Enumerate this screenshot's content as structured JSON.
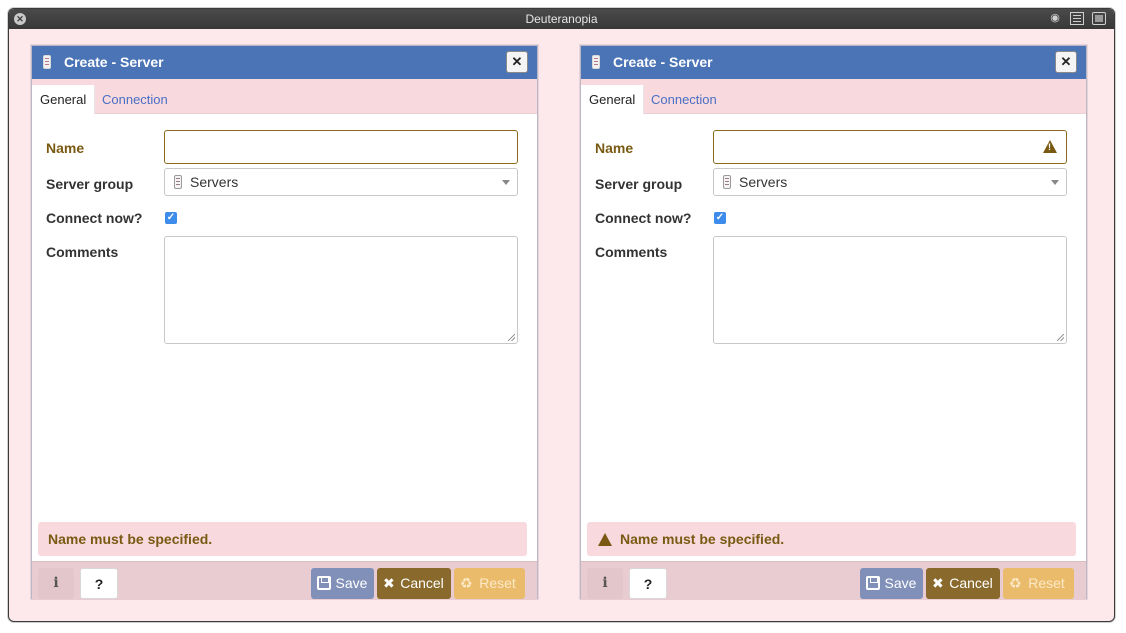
{
  "window": {
    "title": "Deuteranopia"
  },
  "dialogs": [
    {
      "title": "Create - Server",
      "tabs": [
        "General",
        "Connection"
      ],
      "fields": {
        "name_label": "Name",
        "name_value": "",
        "server_group_label": "Server group",
        "server_group_value": "Servers",
        "connect_now_label": "Connect now?",
        "connect_now_checked": true,
        "comments_label": "Comments",
        "comments_value": ""
      },
      "alert": "Name must be specified.",
      "buttons": {
        "info": "i",
        "help": "?",
        "save": "Save",
        "cancel": "Cancel",
        "reset": "Reset"
      }
    },
    {
      "title": "Create - Server",
      "tabs": [
        "General",
        "Connection"
      ],
      "fields": {
        "name_label": "Name",
        "name_value": "",
        "server_group_label": "Server group",
        "server_group_value": "Servers",
        "connect_now_label": "Connect now?",
        "connect_now_checked": true,
        "comments_label": "Comments",
        "comments_value": ""
      },
      "alert": "Name must be specified.",
      "buttons": {
        "info": "i",
        "help": "?",
        "save": "Save",
        "cancel": "Cancel",
        "reset": "Reset"
      }
    }
  ],
  "colors": {
    "header": "#4b74b6",
    "warning_text": "#7a5a12",
    "alert_bg": "#f7d9de",
    "save_btn": "#8090b8",
    "cancel_btn": "#8a6a2c",
    "reset_btn": "#e9bb6a"
  }
}
